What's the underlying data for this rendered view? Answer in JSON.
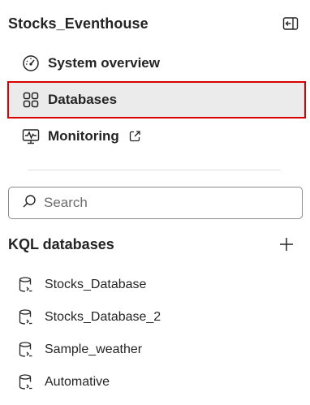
{
  "header": {
    "title": "Stocks_Eventhouse"
  },
  "nav": {
    "items": [
      {
        "label": "System overview",
        "icon": "gauge-icon"
      },
      {
        "label": "Databases",
        "icon": "grid-icon",
        "selected": true
      },
      {
        "label": "Monitoring",
        "icon": "monitor-pulse-icon",
        "external": true
      }
    ]
  },
  "search": {
    "placeholder": "Search",
    "value": ""
  },
  "kql": {
    "title": "KQL databases",
    "add_icon": "plus-icon",
    "databases": [
      {
        "name": "Stocks_Database"
      },
      {
        "name": "Stocks_Database_2"
      },
      {
        "name": "Sample_weather"
      },
      {
        "name": "Automative"
      }
    ]
  },
  "colors": {
    "selected_bg": "#ebebeb",
    "selected_border": "#d90000",
    "text": "#242424"
  }
}
